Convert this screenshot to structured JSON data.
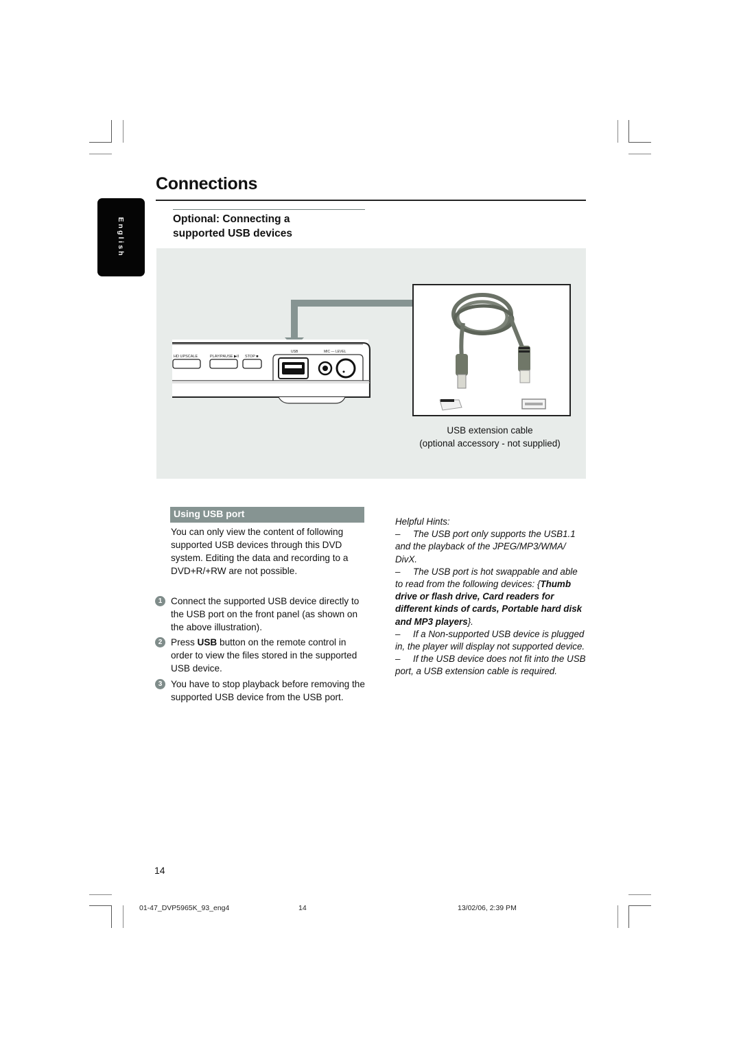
{
  "page": {
    "title": "Connections",
    "language_tab": "English",
    "section_heading": "Optional: Connecting a supported USB devices",
    "section_heading_line1": "Optional: Connecting a",
    "section_heading_line2": "supported USB devices"
  },
  "figure": {
    "player_labels": {
      "hd_upscale": "HD UPSCALE",
      "play_pause": "PLAY/PAUSE ▶II",
      "stop": "STOP ■",
      "usb": "USB",
      "mic_level": "MIC — LEVEL"
    },
    "cable_caption_line1": "USB extension cable",
    "cable_caption_line2": "(optional accessory - not supplied)"
  },
  "using_usb": {
    "heading": "Using USB port",
    "intro": "You can only view the content of following supported USB devices through this DVD system. Editing the data and recording to a DVD+R/+RW are not possible.",
    "steps": [
      {
        "number": "1",
        "text": "Connect the supported USB device directly to the USB port on the front panel (as shown on the above illustration)."
      },
      {
        "number": "2",
        "text_before": "Press ",
        "bold": "USB",
        "text_after": " button on the remote control in order to view the files stored in the supported USB device."
      },
      {
        "number": "3",
        "text": "You have to stop playback before removing the supported USB device from the USB port."
      }
    ]
  },
  "hints": {
    "title": "Helpful Hints:",
    "dash": "–",
    "items": [
      {
        "text": "The USB port only supports the USB1.1 and the playback of the JPEG/MP3/WMA/ DivX."
      },
      {
        "text_before": "The USB port is hot swappable and able to read from the following devices: {",
        "bold": "Thumb drive or flash drive, Card readers for different kinds of cards, Portable hard disk and MP3 players",
        "text_after": "}."
      },
      {
        "text": "If a Non-supported USB device is plugged in, the player will display not supported device."
      },
      {
        "text": "If the USB device does not fit into the USB port, a USB extension cable is required."
      }
    ]
  },
  "footer": {
    "page_number": "14",
    "file_name": "01-47_DVP5965K_93_eng4",
    "print_page": "14",
    "timestamp": "13/02/06, 2:39 PM"
  },
  "colors": {
    "accent_gray_green": "#869492",
    "panel_bg": "#e8ecea",
    "tab_black": "#050505"
  }
}
